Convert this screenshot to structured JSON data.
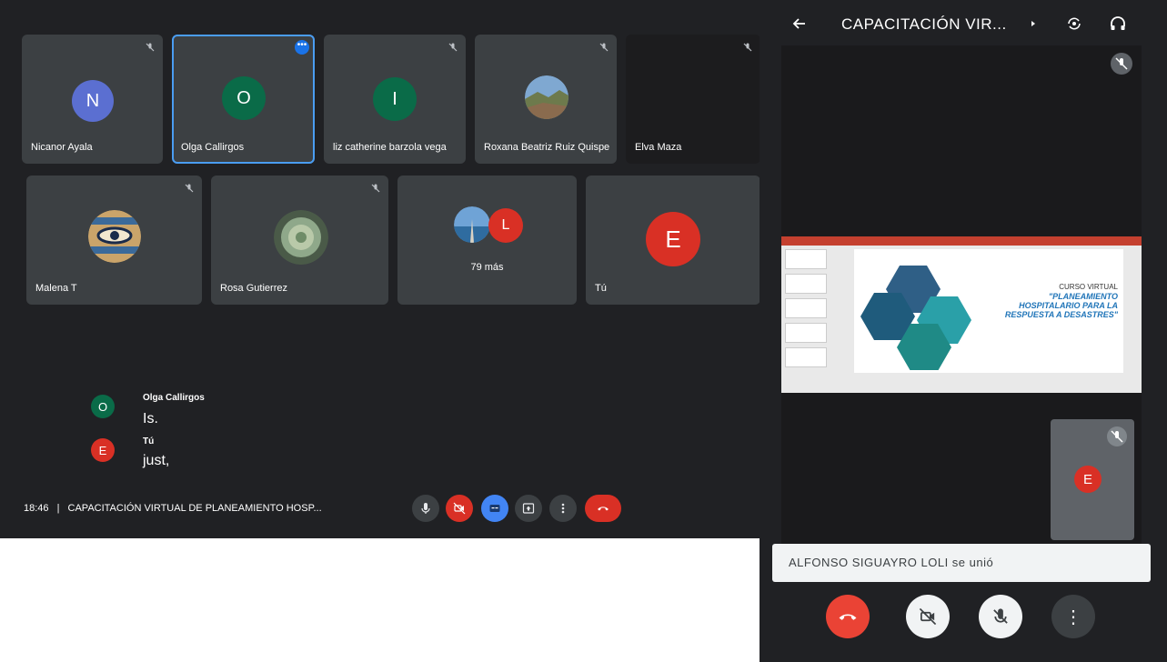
{
  "tiles_row1": [
    {
      "name": "Nicanor Ayala",
      "initial": "N",
      "color": "#5b6fd1"
    },
    {
      "name": "Olga Callirgos",
      "initial": "O",
      "color": "#0a6b48"
    },
    {
      "name": "liz catherine barzola vega",
      "initial": "I",
      "color": "#0a6b48"
    },
    {
      "name": "Roxana Beatriz Ruiz Quispe"
    },
    {
      "name": "Elva Maza"
    }
  ],
  "tiles_row2": [
    {
      "name": "Malena T"
    },
    {
      "name": "Rosa Gutierrez"
    },
    {
      "more": "79 más",
      "initial": "L",
      "color": "#d93025"
    },
    {
      "name": "Tú",
      "initial": "E",
      "color": "#d93025"
    }
  ],
  "more_options_dots": "•••",
  "captions": [
    {
      "speaker": "Olga Callirgos",
      "initial": "O",
      "color": "#0a6b48",
      "text": "Is."
    },
    {
      "speaker": "Tú",
      "initial": "E",
      "color": "#d93025",
      "text": "just,"
    }
  ],
  "meeting": {
    "time": "18:46",
    "separator": "|",
    "title": "CAPACITACIÓN VIRTUAL DE PLANEAMIENTO HOSP..."
  },
  "phone": {
    "title": "CAPACITACIÓN VIR...",
    "slide": {
      "line1": "CURSO VIRTUAL",
      "line2": "\"PLANEAMIENTO HOSPITALARIO PARA LA RESPUESTA A DESASTRES\""
    },
    "self_initial": "E",
    "toast": "ALFONSO SIGUAYRO LOLI se unió",
    "more_icon": "⋮"
  },
  "colors": {
    "accent_blue": "#1a73e8",
    "end_call_red": "#d93025",
    "tile_bg": "#3c4043"
  }
}
